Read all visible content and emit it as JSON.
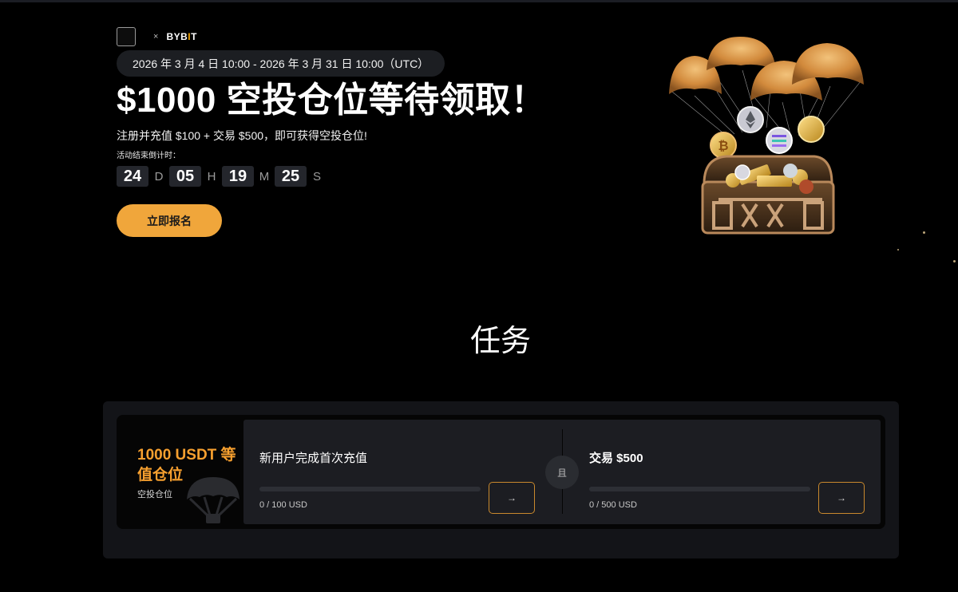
{
  "brand": {
    "separator": "×",
    "bybit_prefix": "BYB",
    "bybit_i": "I",
    "bybit_suffix": "T",
    "accent_color": "#f0a63b"
  },
  "hero": {
    "date_range": "2026 年 3 月 4 日 10:00 - 2026 年 3 月 31 日 10:00（UTC）",
    "title": "$1000 空投仓位等待领取！",
    "subtitle": "注册并充值 $100 + 交易 $500，即可获得空投仓位!",
    "countdown_label": "活动结束倒计时：",
    "countdown": {
      "days": "24",
      "days_unit": "D",
      "hours": "05",
      "hours_unit": "H",
      "minutes": "19",
      "minutes_unit": "M",
      "seconds": "25",
      "seconds_unit": "S"
    },
    "cta_label": "立即报名"
  },
  "tasks_section": {
    "title": "任务",
    "reward": {
      "title": "1000 USDT 等值仓位",
      "subtitle": "空投仓位"
    },
    "and_label": "且",
    "tasks": [
      {
        "name": "新用户完成首次充值",
        "progress_text": "0 / 100 USD",
        "progress_fraction": 0,
        "button_icon": "→"
      },
      {
        "name": "交易 $500",
        "progress_text": "0 / 500 USD",
        "progress_fraction": 0,
        "button_icon": "→"
      }
    ]
  }
}
